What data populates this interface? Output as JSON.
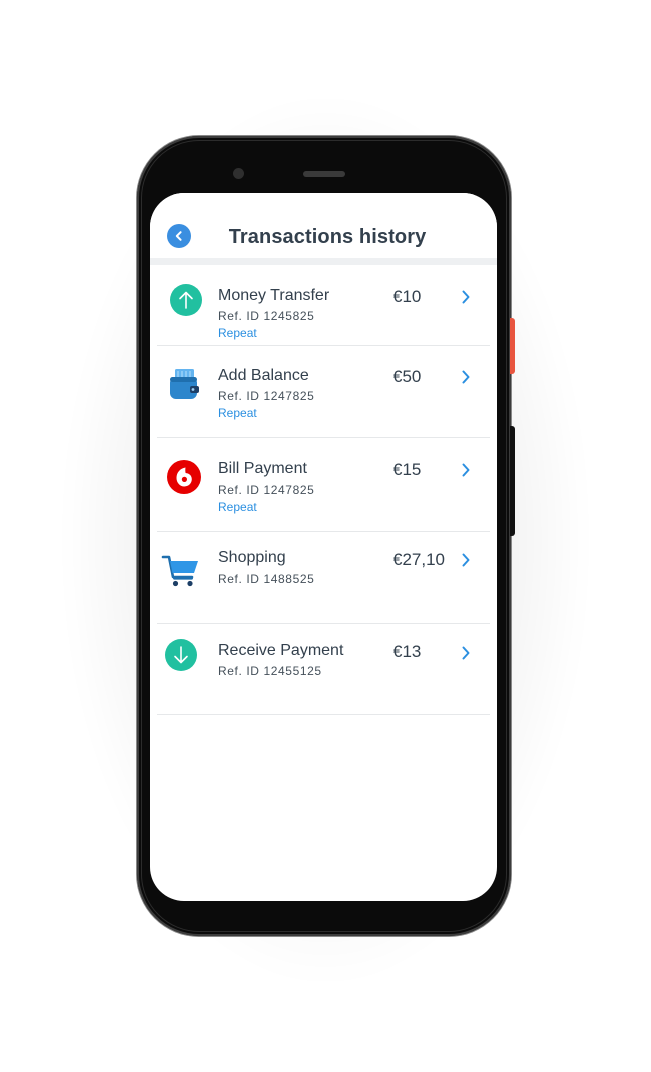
{
  "header": {
    "title": "Transactions history",
    "back_icon": "chevron-left-icon"
  },
  "colors": {
    "accent_blue": "#3a8ee0",
    "link_blue": "#2b8fe0",
    "green": "#21c0a0",
    "vodafone_red": "#e60000",
    "text_dark": "#33404d"
  },
  "transactions": [
    {
      "title": "Money Transfer",
      "ref": "Ref. ID  1245825",
      "amount": "€10",
      "repeat_label": "Repeat",
      "icon": "arrow-up-icon"
    },
    {
      "title": "Add Balance",
      "ref": "Ref. ID  1247825",
      "amount": "€50",
      "repeat_label": "Repeat",
      "icon": "wallet-icon"
    },
    {
      "title": "Bill Payment",
      "ref": "Ref. ID  1247825",
      "amount": "€15",
      "repeat_label": "Repeat",
      "icon": "vodafone-logo-icon"
    },
    {
      "title": "Shopping",
      "ref": "Ref. ID  1488525",
      "amount": "€27,10",
      "icon": "shopping-cart-icon"
    },
    {
      "title": "Receive Payment",
      "ref": "Ref. ID  12455125",
      "amount": "€13",
      "icon": "arrow-down-icon"
    }
  ]
}
